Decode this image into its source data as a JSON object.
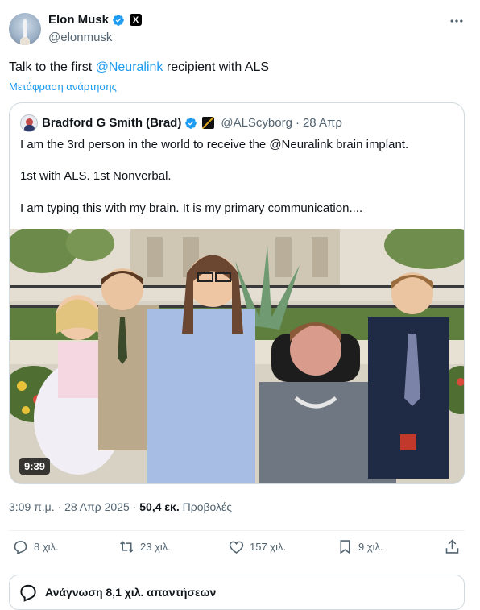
{
  "author": {
    "display_name": "Elon Musk",
    "handle": "@elonmusk",
    "x_badge": "X"
  },
  "post": {
    "text_prefix": "Talk to the first ",
    "mention": "@Neuralink",
    "text_suffix": " recipient with ALS",
    "translate_label": "Μετάφραση ανάρτησης"
  },
  "quote": {
    "display_name": "Bradford G Smith (Brad)",
    "handle": "@ALScyborg",
    "separator": "·",
    "date": "28 Απρ",
    "lines": [
      "I am the 3rd person in the world to receive the @Neuralink brain implant.",
      "1st with ALS. 1st Nonverbal.",
      "I am typing this with my brain. It is my primary communication...."
    ],
    "video_duration": "9:39"
  },
  "meta": {
    "time": "3:09 π.μ.",
    "separator": "·",
    "date": "28 Απρ 2025",
    "separator2": "·",
    "views_count": "50,4 εκ.",
    "views_label": "Προβολές"
  },
  "actions": {
    "replies": "8 χιλ.",
    "reposts": "23 χιλ.",
    "likes": "157 χιλ.",
    "bookmarks": "9 χιλ."
  },
  "replies_bar": {
    "label": "Ανάγνωση 8,1 χιλ. απαντήσεων"
  },
  "colors": {
    "accent": "#1d9bf0",
    "secondary_text": "#536471",
    "border": "#cfd9de"
  },
  "icons": [
    "verified-badge-icon",
    "x-logo-icon",
    "more-options-icon",
    "reply-icon",
    "repost-icon",
    "like-icon",
    "bookmark-icon",
    "share-icon",
    "speech-bubble-icon"
  ]
}
